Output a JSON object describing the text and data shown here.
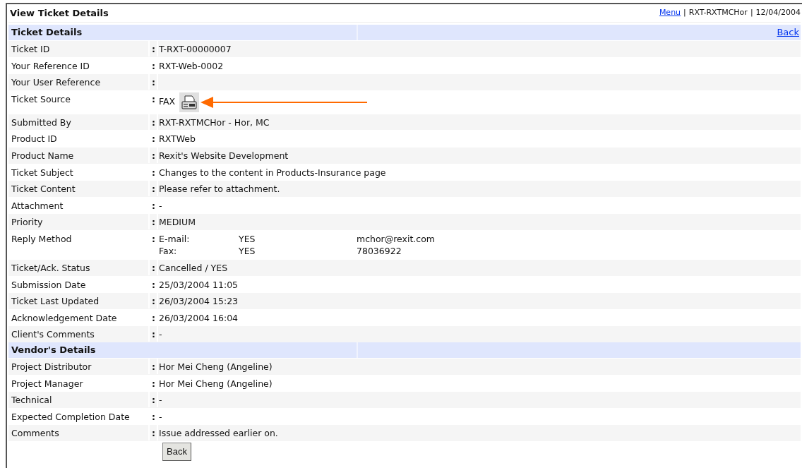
{
  "title": "View Ticket Details",
  "top_links": [
    {
      "kind": "link",
      "text": "Menu"
    },
    {
      "kind": "separator",
      "text": "|"
    },
    {
      "kind": "text",
      "text": "RXT-RXTMCHor"
    },
    {
      "kind": "separator",
      "text": "|"
    },
    {
      "kind": "text",
      "text": "12/04/2004"
    }
  ],
  "colon": ":",
  "sections": [
    {
      "heading": "Ticket Details",
      "back_link": "Back",
      "rows": [
        {
          "kind": "text",
          "label": "Ticket ID",
          "value": "T-RXT-00000007"
        },
        {
          "kind": "text",
          "label": "Your Reference ID",
          "value": "RXT-Web-0002"
        },
        {
          "kind": "text",
          "label": "Your User Reference"
        },
        {
          "kind": "source",
          "label": "Ticket Source",
          "value": "FAX"
        },
        {
          "kind": "text",
          "label": "Submitted By",
          "value": "RXT-RXTMCHor - Hor, MC"
        },
        {
          "kind": "text",
          "label": "Product ID",
          "value": "RXTWeb"
        },
        {
          "kind": "text",
          "label": "Product Name",
          "value": "Rexit's Website Development"
        },
        {
          "kind": "text",
          "label": "Ticket Subject",
          "value": "Changes to the content in Products-Insurance page"
        },
        {
          "kind": "text",
          "label": "Ticket Content",
          "value": "Please refer to attachment."
        },
        {
          "kind": "text",
          "label": "Attachment",
          "value": "-"
        },
        {
          "kind": "text",
          "label": "Priority",
          "value": "MEDIUM"
        },
        {
          "kind": "methods",
          "label": "Reply Method",
          "methods": [
            {
              "method": "E-mail:",
              "enabled": "YES",
              "address": "mchor@rexit.com"
            },
            {
              "method": "Fax:",
              "enabled": "YES",
              "address": "78036922"
            }
          ]
        },
        {
          "kind": "text",
          "label": "Ticket/Ack. Status",
          "value": "Cancelled / YES"
        },
        {
          "kind": "text",
          "label": "Submission Date",
          "value": "25/03/2004 11:05"
        },
        {
          "kind": "text",
          "label": "Ticket Last Updated",
          "value": "26/03/2004 15:23"
        },
        {
          "kind": "text",
          "label": "Acknowledgement Date",
          "value": "26/03/2004 16:04"
        },
        {
          "kind": "text",
          "label": "Client's Comments",
          "value": "-"
        }
      ]
    },
    {
      "heading": "Vendor's Details",
      "rows": [
        {
          "kind": "text",
          "label": "Project Distributor",
          "value": "Hor Mei Cheng (Angeline)"
        },
        {
          "kind": "text",
          "label": "Project Manager",
          "value": "Hor Mei Cheng (Angeline)"
        },
        {
          "kind": "text",
          "label": "Technical",
          "value": "-"
        },
        {
          "kind": "text",
          "label": "Expected Completion Date",
          "value": "-"
        },
        {
          "kind": "text",
          "label": "Comments",
          "value": "Issue addressed earlier on."
        }
      ]
    }
  ],
  "button": "Back"
}
